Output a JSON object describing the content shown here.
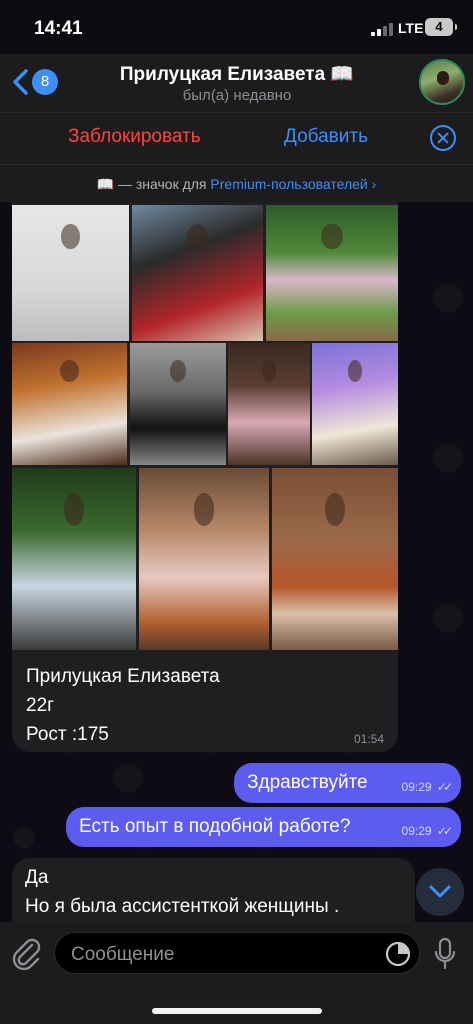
{
  "status_bar": {
    "time": "14:41",
    "network": "LTE",
    "battery": "4"
  },
  "header": {
    "back_count": "8",
    "contact_name": "Прилуцкая Елизавета 📖",
    "last_seen": "был(а) недавно"
  },
  "action_bar": {
    "block_label": "Заблокировать",
    "add_label": "Добавить"
  },
  "premium_notice": {
    "text": "📖 — значок для ",
    "link": "Premium-пользователей",
    "chevron": "›"
  },
  "album_message": {
    "caption_lines": [
      "Прилуцкая Елизавета",
      "22г",
      "Рост :175"
    ],
    "time": "01:54"
  },
  "outgoing_messages": [
    {
      "text": "Здравствуйте",
      "time": "09:29",
      "ticks": "✓✓"
    },
    {
      "text": "Есть опыт в подобной работе?",
      "time": "09:29",
      "ticks": "✓✓"
    }
  ],
  "incoming_message": {
    "lines": [
      "Да",
      "Но я была ассистенткой женщины ."
    ]
  },
  "input": {
    "placeholder": "Сообщение"
  },
  "colors": {
    "accent": "#3e8ef7",
    "block_red": "#ff453a",
    "outgoing_bubble": "#5c5cf0",
    "incoming_bubble": "#1f1f22",
    "bar_background": "#1c1c1e"
  },
  "icons": [
    "back-chevron-icon",
    "close-icon",
    "paperclip-icon",
    "sticker-icon",
    "microphone-icon",
    "scroll-down-icon",
    "signal-icon",
    "battery-icon"
  ]
}
